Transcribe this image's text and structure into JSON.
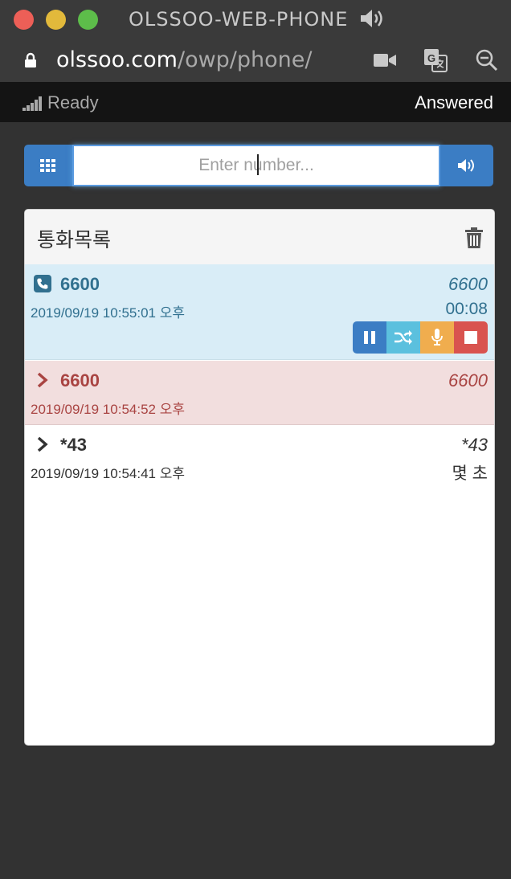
{
  "window": {
    "title": "OLSSOO-WEB-PHONE",
    "url_domain": "olssoo.com",
    "url_path": "/owp/phone/"
  },
  "status": {
    "left": "Ready",
    "right": "Answered"
  },
  "dial": {
    "placeholder": "Enter number..."
  },
  "panel": {
    "title": "통화목록"
  },
  "calls": [
    {
      "number": "6600",
      "datetime": "2019/09/19 10:55:01 오후",
      "display": "6600",
      "duration": "00:08",
      "state": "active",
      "icon": "phone-icon"
    },
    {
      "number": "6600",
      "datetime": "2019/09/19 10:54:52 오후",
      "display": "6600",
      "state": "missed",
      "icon": "chevron-right-icon"
    },
    {
      "number": "*43",
      "datetime": "2019/09/19 10:54:41 오후",
      "display": "*43",
      "duration": "몇 초",
      "state": "ended",
      "icon": "chevron-right-icon"
    }
  ],
  "colors": {
    "primary": "#3b7dc4",
    "info": "#5bc0de",
    "warning": "#f0ad4e",
    "danger": "#d9534f",
    "active_row": "#d9edf7",
    "missed_row": "#f2dede"
  }
}
